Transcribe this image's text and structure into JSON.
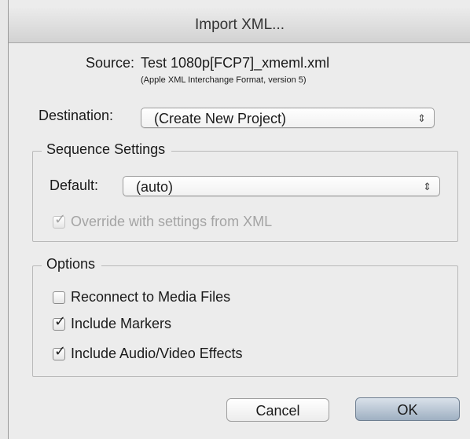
{
  "dialog": {
    "title": "Import XML..."
  },
  "source": {
    "label": "Source:",
    "value": "Test 1080p[FCP7]_xmeml.xml",
    "subtitle": "(Apple XML Interchange Format, version 5)"
  },
  "destination": {
    "label": "Destination:",
    "value": "(Create New Project)",
    "chevron": "⇕"
  },
  "sequence_settings": {
    "title": "Sequence Settings",
    "default_label": "Default:",
    "default_value": "(auto)",
    "chevron": "⇕",
    "override": {
      "label": "Override with settings from XML",
      "checked": true,
      "enabled": false
    }
  },
  "options": {
    "title": "Options",
    "items": [
      {
        "label": "Reconnect to Media Files",
        "checked": false
      },
      {
        "label": "Include Markers",
        "checked": true
      },
      {
        "label": "Include Audio/Video Effects",
        "checked": true
      }
    ]
  },
  "buttons": {
    "cancel": "Cancel",
    "ok": "OK"
  }
}
